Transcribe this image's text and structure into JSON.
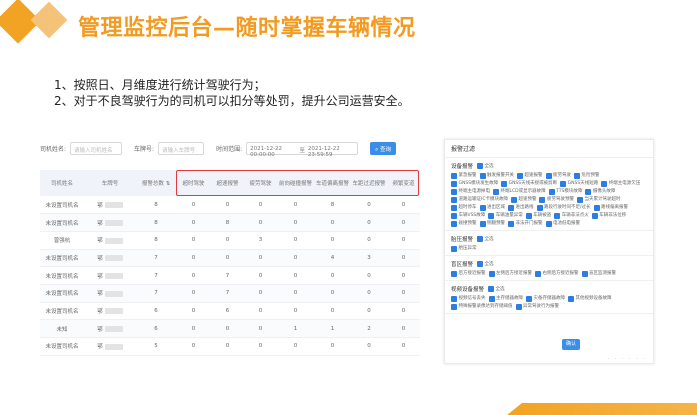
{
  "header": {
    "title": "管理监控后台—随时掌握车辆情况"
  },
  "bullets": [
    "1、按照日、月维度进行统计驾驶行为；",
    "2、对于不良驾驶行为的司机可以扣分等处罚，提升公司运营安全。"
  ],
  "filters": {
    "driver_label": "司机姓名:",
    "driver_placeholder": "请输入司机姓名",
    "plate_label": "车牌号:",
    "plate_placeholder": "请输入车牌号",
    "time_label": "时间范围:",
    "time_start": "2021-12-22 00:00:00",
    "time_sep": "至",
    "time_end": "2021-12-22 23:59:59",
    "search_label": "查询"
  },
  "table": {
    "headers": [
      "司机姓名",
      "车牌号",
      "报警总数",
      "超时驾驶",
      "超速报警",
      "疲劳驾驶",
      "前向碰撞报警",
      "车道偏离报警",
      "车距过近报警",
      "频繁变道"
    ],
    "rows": [
      [
        "未设置司机名",
        "鄂",
        "8",
        "0",
        "0",
        "0",
        "0",
        "8",
        "0",
        "0"
      ],
      [
        "未设置司机名",
        "鄂",
        "8",
        "0",
        "8",
        "0",
        "0",
        "0",
        "0",
        "0"
      ],
      [
        "曾强杭",
        "鄂",
        "8",
        "0",
        "0",
        "3",
        "0",
        "0",
        "0",
        "0"
      ],
      [
        "未设置司机名",
        "鄂",
        "7",
        "0",
        "0",
        "0",
        "0",
        "4",
        "3",
        "0"
      ],
      [
        "未设置司机名",
        "鄂",
        "7",
        "0",
        "7",
        "0",
        "0",
        "0",
        "0",
        "0"
      ],
      [
        "未设置司机名",
        "鄂",
        "7",
        "0",
        "7",
        "0",
        "0",
        "0",
        "0",
        "0"
      ],
      [
        "未设置司机名",
        "鄂",
        "6",
        "0",
        "6",
        "0",
        "0",
        "0",
        "0",
        "0"
      ],
      [
        "未知",
        "鄂",
        "6",
        "0",
        "0",
        "0",
        "1",
        "1",
        "2",
        "0"
      ],
      [
        "未设置司机名",
        "鄂",
        "5",
        "0",
        "0",
        "0",
        "0",
        "0",
        "0",
        "0"
      ]
    ]
  },
  "filter_panel": {
    "title": "报警过滤",
    "all_label": "全选",
    "groups": [
      {
        "name": "设备报警",
        "items": [
          "紧急报警",
          "触发报警开关",
          "超速报警",
          "疲劳驾驶",
          "危险预警",
          "GNSS模块发生故障",
          "GNSS天线未接或被剪断",
          "GNSS天线短路",
          "终端主电源欠压",
          "终端主电源掉电",
          "终端LCD或显示器故障",
          "TTS模块故障",
          "摄像头故障",
          "道路运输证IC卡模块故障",
          "超速预警",
          "疲劳驾驶预警",
          "当天累计驾驶超时",
          "超时停车",
          "进出区域",
          "进出路线",
          "路段行驶时间不足/过长",
          "路线偏离报警",
          "车辆VSS故障",
          "车辆油量异常",
          "车辆被盗",
          "车辆非法点火",
          "车辆非法位移",
          "碰撞预警",
          "侧翻预警",
          "非法开门报警",
          "电池低电报警"
        ]
      },
      {
        "name": "胎压报警",
        "items": [
          "胎压异常"
        ]
      },
      {
        "name": "盲区报警",
        "items": [
          "后方接近报警",
          "左侧后方接近报警",
          "右侧后方接近报警",
          "盲区监测报警"
        ]
      },
      {
        "name": "视频设备报警",
        "items": [
          "视频信号丢失",
          "主存储器故障",
          "灾备存储器故障",
          "其他视频设备故障",
          "特殊报警录像达到存储阈值",
          "异常驾驶行为报警"
        ]
      }
    ],
    "confirm_label": "确认"
  },
  "colors": {
    "accent": "#f39a20",
    "primary": "#3b8ee8",
    "alert_outline": "#e23b3b"
  }
}
